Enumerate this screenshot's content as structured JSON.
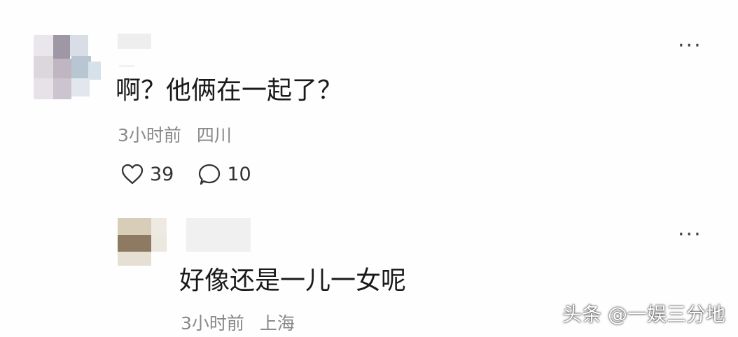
{
  "comments": [
    {
      "text": "啊？他俩在一起了？",
      "time": "3小时前",
      "location": "四川",
      "likes": "39",
      "replies": "10",
      "more_label": "···"
    },
    {
      "text": "好像还是一儿一女呢",
      "time": "3小时前",
      "location": "上海",
      "more_label": "···"
    }
  ],
  "icons": {
    "like": "heart-icon",
    "reply": "comment-bubble-icon",
    "more": "more-dots-icon"
  },
  "watermark": "头条 @一娱三分地"
}
